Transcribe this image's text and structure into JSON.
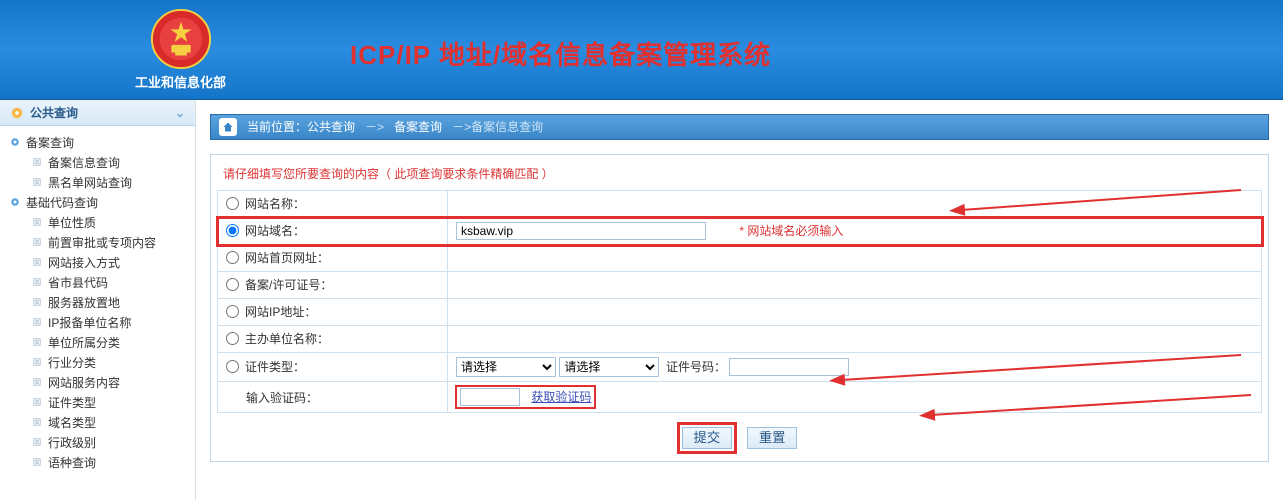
{
  "header": {
    "org": "工业和信息化部",
    "title_a": "ICP/IP",
    "title_b": "地址/域名信息备案管理系统"
  },
  "sidebar": {
    "header": "公共查询",
    "groups": [
      {
        "label": "备案查询",
        "children": [
          {
            "label": "备案信息查询"
          },
          {
            "label": "黑名单网站查询"
          }
        ]
      },
      {
        "label": "基础代码查询",
        "children": [
          {
            "label": "单位性质"
          },
          {
            "label": "前置审批或专项内容"
          },
          {
            "label": "网站接入方式"
          },
          {
            "label": "省市县代码"
          },
          {
            "label": "服务器放置地"
          },
          {
            "label": "IP报备单位名称"
          },
          {
            "label": "单位所属分类"
          },
          {
            "label": "行业分类"
          },
          {
            "label": "网站服务内容"
          },
          {
            "label": "证件类型"
          },
          {
            "label": "域名类型"
          },
          {
            "label": "行政级别"
          },
          {
            "label": "语种查询"
          }
        ]
      }
    ]
  },
  "breadcrumb": {
    "prefix": "当前位置：",
    "l1": "公共查询",
    "sep": "－>",
    "l2": "备案查询",
    "l3": "备案信息查询"
  },
  "form": {
    "hint": "请仔细填写您所要查询的内容（ 此项查询要求条件精确匹配 ）",
    "rows": {
      "website_name": "网站名称：",
      "domain": "网站域名：",
      "homepage": "网站首页网址：",
      "license": "备案/许可证号：",
      "ip": "网站IP地址：",
      "sponsor": "主办单位名称：",
      "cert_type": "证件类型：",
      "captcha": "输入验证码："
    },
    "domain_value": "ksbaw.vip",
    "domain_note": "*  网站域名必须输入",
    "cert_sel1": "请选择",
    "cert_sel2": "请选择",
    "cert_no_label": "证件号码：",
    "captcha_link": "获取验证码"
  },
  "buttons": {
    "submit": "提交",
    "reset": "重置"
  }
}
